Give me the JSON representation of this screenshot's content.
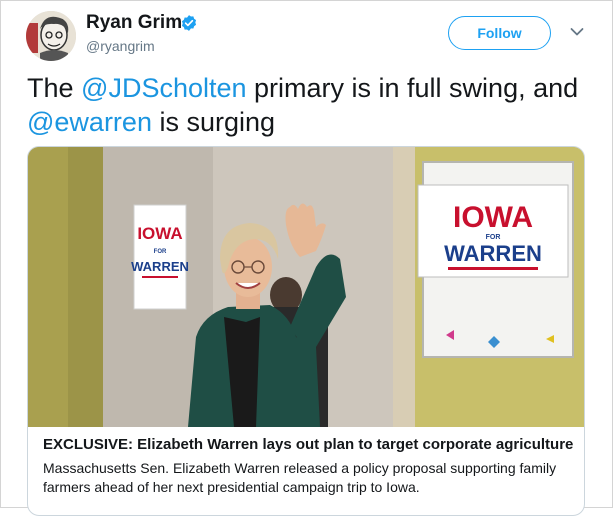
{
  "tweet": {
    "author_name": "Ryan Grim",
    "author_handle": "@ryangrim",
    "follow_label": "Follow",
    "text_parts": [
      "The ",
      "@JDScholten",
      " primary is in full swing, and ",
      "@ewarren",
      " is surging"
    ]
  },
  "card": {
    "sign_left": [
      "IOWA",
      "FOR",
      "WARREN"
    ],
    "sign_right": [
      "IOWA",
      "FOR",
      "WARREN"
    ],
    "title": "EXCLUSIVE: Elizabeth Warren lays out plan to target corporate agriculture, s...",
    "description": "Massachusetts Sen. Elizabeth Warren released a policy proposal supporting family farmers ahead of her next presidential campaign trip to Iowa."
  },
  "icons": [
    "verified-badge-icon",
    "chevron-down-icon"
  ],
  "colors": {
    "accent": "#1da1f2",
    "mention": "#1b95e0",
    "sign_red": "#c8102e",
    "sign_blue": "#1b3f8b"
  }
}
